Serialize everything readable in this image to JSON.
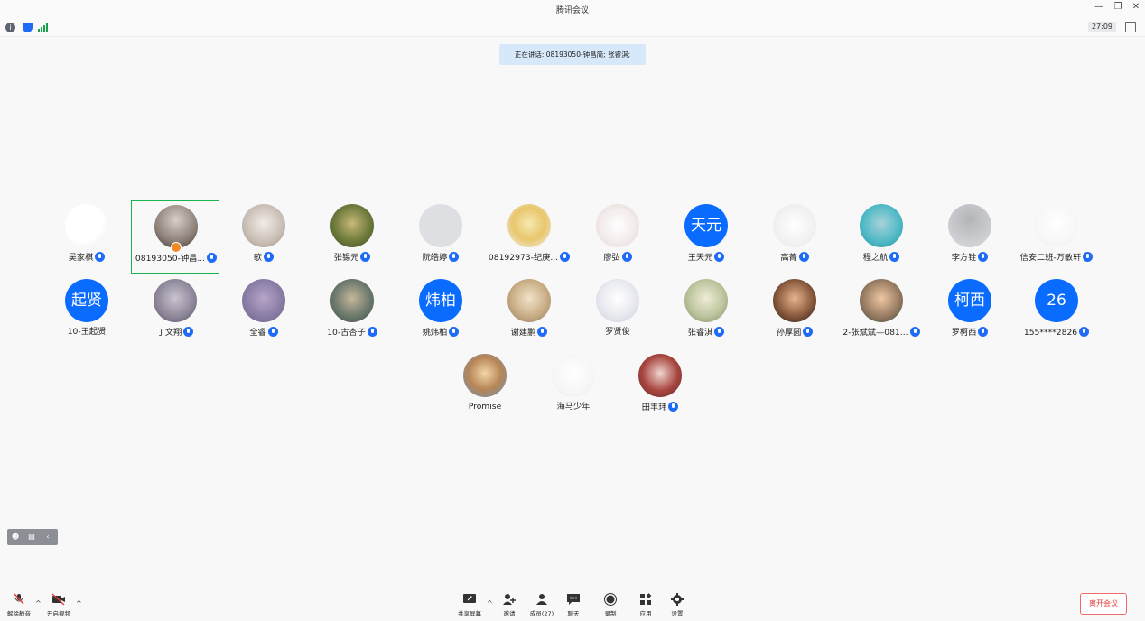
{
  "window": {
    "title": "腾讯会议",
    "controls": [
      "minimize",
      "restore",
      "close"
    ]
  },
  "status": {
    "timer": "27:09"
  },
  "speaking": {
    "text": "正在讲话: 08193050-钟昌简; 张睿淇;"
  },
  "participants": [
    {
      "name": "吴家棋",
      "avatar_text": "",
      "mic": true
    },
    {
      "name": "08193050-钟昌...",
      "avatar_text": "",
      "mic": true,
      "active": true
    },
    {
      "name": "欹",
      "avatar_text": "",
      "mic": true
    },
    {
      "name": "张锡元",
      "avatar_text": "",
      "mic": true
    },
    {
      "name": "阮皓婷",
      "avatar_text": "",
      "mic": true
    },
    {
      "name": "08192973-纪庚...",
      "avatar_text": "",
      "mic": true
    },
    {
      "name": "廖弘",
      "avatar_text": "",
      "mic": true
    },
    {
      "name": "王天元",
      "avatar_text": "天元",
      "mic": true
    },
    {
      "name": "高菁",
      "avatar_text": "",
      "mic": true
    },
    {
      "name": "程之航",
      "avatar_text": "",
      "mic": true
    },
    {
      "name": "李方铨",
      "avatar_text": "",
      "mic": true
    },
    {
      "name": "信安二班-万敏轩",
      "avatar_text": "",
      "mic": true
    },
    {
      "name": "10-王起贤",
      "avatar_text": "起贤",
      "mic": false
    },
    {
      "name": "丁文翔",
      "avatar_text": "",
      "mic": true
    },
    {
      "name": "全睿",
      "avatar_text": "",
      "mic": true
    },
    {
      "name": "10-古杏子",
      "avatar_text": "",
      "mic": true
    },
    {
      "name": "姚炜柏",
      "avatar_text": "炜柏",
      "mic": true
    },
    {
      "name": "谢建鹏",
      "avatar_text": "",
      "mic": true
    },
    {
      "name": "罗贤俊",
      "avatar_text": "",
      "mic": false
    },
    {
      "name": "张睿淇",
      "avatar_text": "",
      "mic": true
    },
    {
      "name": "孙厚圆",
      "avatar_text": "",
      "mic": true
    },
    {
      "name": "2-张斌斌—081...",
      "avatar_text": "",
      "mic": true
    },
    {
      "name": "罗柯西",
      "avatar_text": "柯西",
      "mic": true
    },
    {
      "name": "155****2826",
      "avatar_text": "26",
      "mic": true
    },
    {
      "name": "Promise",
      "avatar_text": "",
      "mic": false
    },
    {
      "name": "海马少年",
      "avatar_text": "",
      "mic": false
    },
    {
      "name": "田丰玮",
      "avatar_text": "",
      "mic": true
    }
  ],
  "toolbar": {
    "unmute": "解除静音",
    "start_video": "开启视频",
    "share_screen": "共享屏幕",
    "invite": "邀请",
    "members": "成员(27)",
    "chat": "聊天",
    "record": "录制",
    "apps": "应用",
    "settings": "设置",
    "leave": "离开会议"
  },
  "colors": {
    "accent": "#1e6bf5",
    "active_border": "#19b350",
    "leave": "#e23b3b",
    "speaking_bg": "#d8e8fb"
  }
}
